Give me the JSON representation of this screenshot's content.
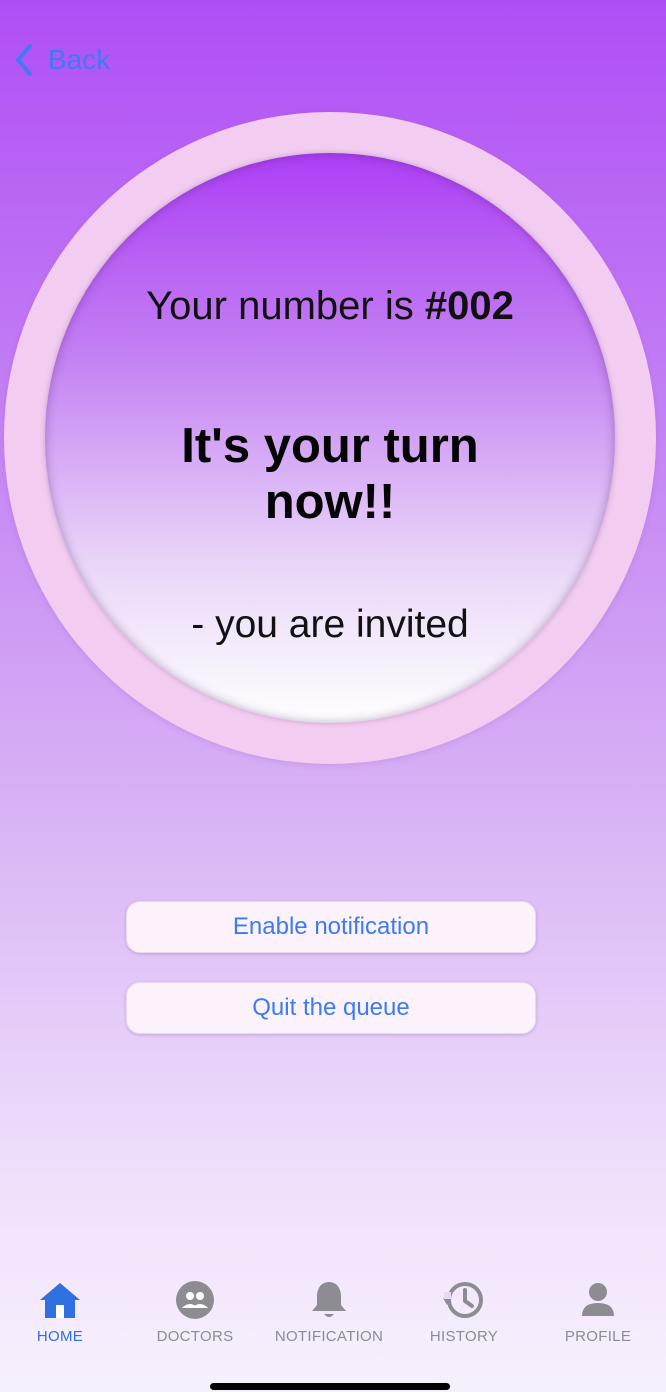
{
  "nav": {
    "back_label": "Back"
  },
  "status": {
    "number_prefix": "Your number is ",
    "number": "#002",
    "headline": "It's your turn now!!",
    "subline": "- you are invited"
  },
  "actions": {
    "enable_notification": "Enable notification",
    "quit_queue": "Quit the queue"
  },
  "tabs": [
    {
      "label": "HOME",
      "icon": "home-icon",
      "active": true
    },
    {
      "label": "DOCTORS",
      "icon": "doctors-group-icon",
      "active": false
    },
    {
      "label": "NOTIFICATION",
      "icon": "bell-icon",
      "active": false
    },
    {
      "label": "HISTORY",
      "icon": "history-icon",
      "active": false
    },
    {
      "label": "PROFILE",
      "icon": "person-icon",
      "active": false
    }
  ],
  "colors": {
    "accent": "#3d7bf0",
    "inactive_tab": "#8c8c92",
    "ring": "#f3cdf1",
    "background_top": "#b04ef6",
    "background_bottom": "#f7f0fc"
  }
}
